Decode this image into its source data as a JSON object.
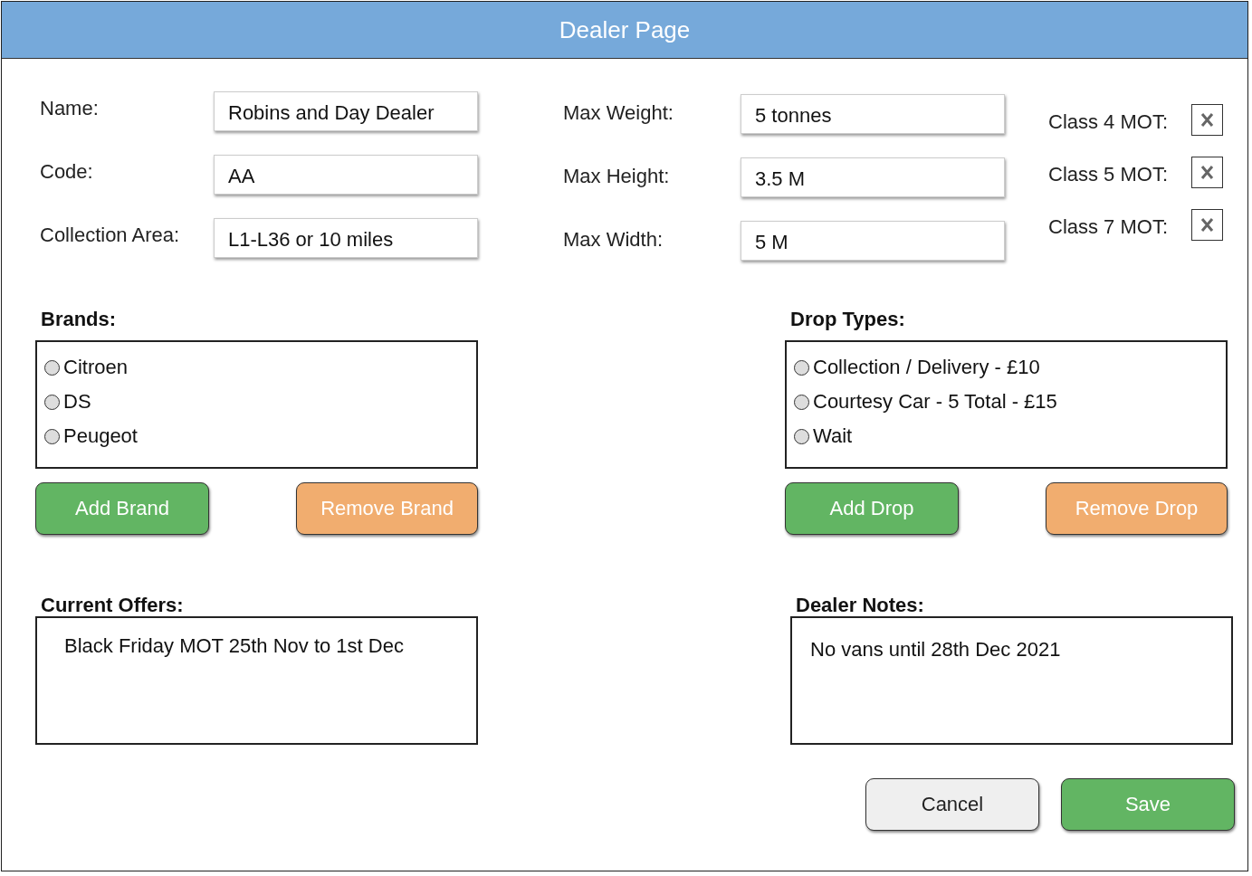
{
  "window": {
    "title": "Dealer Page"
  },
  "fields_left": [
    {
      "label": "Name:",
      "value": "Robins and Day Dealer"
    },
    {
      "label": "Code:",
      "value": "AA"
    },
    {
      "label": "Collection Area:",
      "value": "L1-L36 or 10 miles"
    }
  ],
  "fields_middle": [
    {
      "label": "Max Weight:",
      "value": "5 tonnes"
    },
    {
      "label": "Max Height:",
      "value": "3.5 M"
    },
    {
      "label": "Max Width:",
      "value": "5 M"
    }
  ],
  "mot_classes": [
    {
      "label": "Class 4 MOT:",
      "checked": true
    },
    {
      "label": "Class 5 MOT:",
      "checked": true
    },
    {
      "label": "Class 7 MOT:",
      "checked": true
    }
  ],
  "brands": {
    "title": "Brands:",
    "items": [
      {
        "label": "Citroen",
        "selected": false
      },
      {
        "label": "DS",
        "selected": false
      },
      {
        "label": "Peugeot",
        "selected": false
      }
    ],
    "add_button": "Add Brand",
    "remove_button": "Remove Brand"
  },
  "drop_types": {
    "title": "Drop Types:",
    "items": [
      {
        "label": "Collection / Delivery - £10",
        "selected": false
      },
      {
        "label": "Courtesy Car - 5 Total - £15",
        "selected": false
      },
      {
        "label": "Wait",
        "selected": false
      }
    ],
    "add_button": "Add Drop",
    "remove_button": "Remove Drop"
  },
  "current_offers": {
    "title": "Current Offers:",
    "text": "Black Friday MOT 25th Nov to 1st Dec"
  },
  "dealer_notes": {
    "title": "Dealer Notes:",
    "text": "No vans until 28th Dec 2021"
  },
  "buttons": {
    "cancel": "Cancel",
    "save": "Save"
  }
}
